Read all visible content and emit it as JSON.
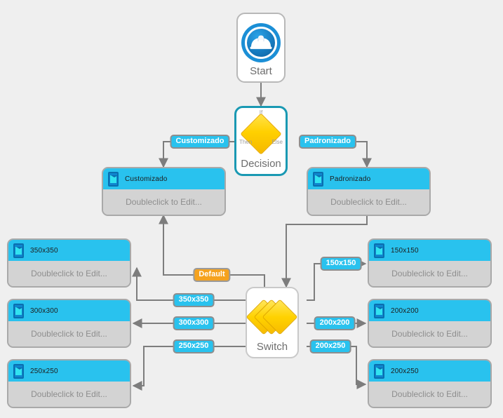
{
  "diagram": {
    "background_color": "#efefef",
    "edge_color": "#808080",
    "accent_cyan": "#29c2ee",
    "accent_orange": "#f5a21e",
    "accent_yellow": "#ffd200",
    "accent_blue": "#1b8fd6",
    "placeholder_text": "Doubleclick to Edit..."
  },
  "nodes": {
    "start": {
      "title": "Start",
      "icon": "hard-hat-icon"
    },
    "decision": {
      "title": "Decision",
      "port_if": "If",
      "port_then": "Then",
      "port_else": "Else",
      "icon": "diamond-icon"
    },
    "switch": {
      "title": "Switch",
      "icon": "stacked-diamonds-icon"
    },
    "cards": [
      {
        "id": "customizado",
        "title": "Customizado",
        "body": "Doubleclick to Edit...",
        "icon": "device-icon"
      },
      {
        "id": "padronizado",
        "title": "Padronizado",
        "body": "Doubleclick to Edit...",
        "icon": "device-icon"
      },
      {
        "id": "size-350x350",
        "title": "350x350",
        "body": "Doubleclick to Edit...",
        "icon": "device-icon"
      },
      {
        "id": "size-300x300",
        "title": "300x300",
        "body": "Doubleclick to Edit...",
        "icon": "device-icon"
      },
      {
        "id": "size-250x250",
        "title": "250x250",
        "body": "Doubleclick to Edit...",
        "icon": "device-icon"
      },
      {
        "id": "size-150x150",
        "title": "150x150",
        "body": "Doubleclick to Edit...",
        "icon": "device-icon"
      },
      {
        "id": "size-200x200",
        "title": "200x200",
        "body": "Doubleclick to Edit...",
        "icon": "device-icon"
      },
      {
        "id": "size-200x250",
        "title": "200x250",
        "body": "Doubleclick to Edit...",
        "icon": "device-icon"
      }
    ]
  },
  "edge_labels": [
    {
      "id": "customizado",
      "text": "Customizado",
      "style": "cyan"
    },
    {
      "id": "padronizado",
      "text": "Padronizado",
      "style": "cyan"
    },
    {
      "id": "default",
      "text": "Default",
      "style": "orange"
    },
    {
      "id": "e350",
      "text": "350x350",
      "style": "cyan"
    },
    {
      "id": "e300",
      "text": "300x300",
      "style": "cyan"
    },
    {
      "id": "e250",
      "text": "250x250",
      "style": "cyan"
    },
    {
      "id": "e150",
      "text": "150x150",
      "style": "cyan"
    },
    {
      "id": "e200x200",
      "text": "200x200",
      "style": "cyan"
    },
    {
      "id": "e200x250",
      "text": "200x250",
      "style": "cyan"
    }
  ]
}
